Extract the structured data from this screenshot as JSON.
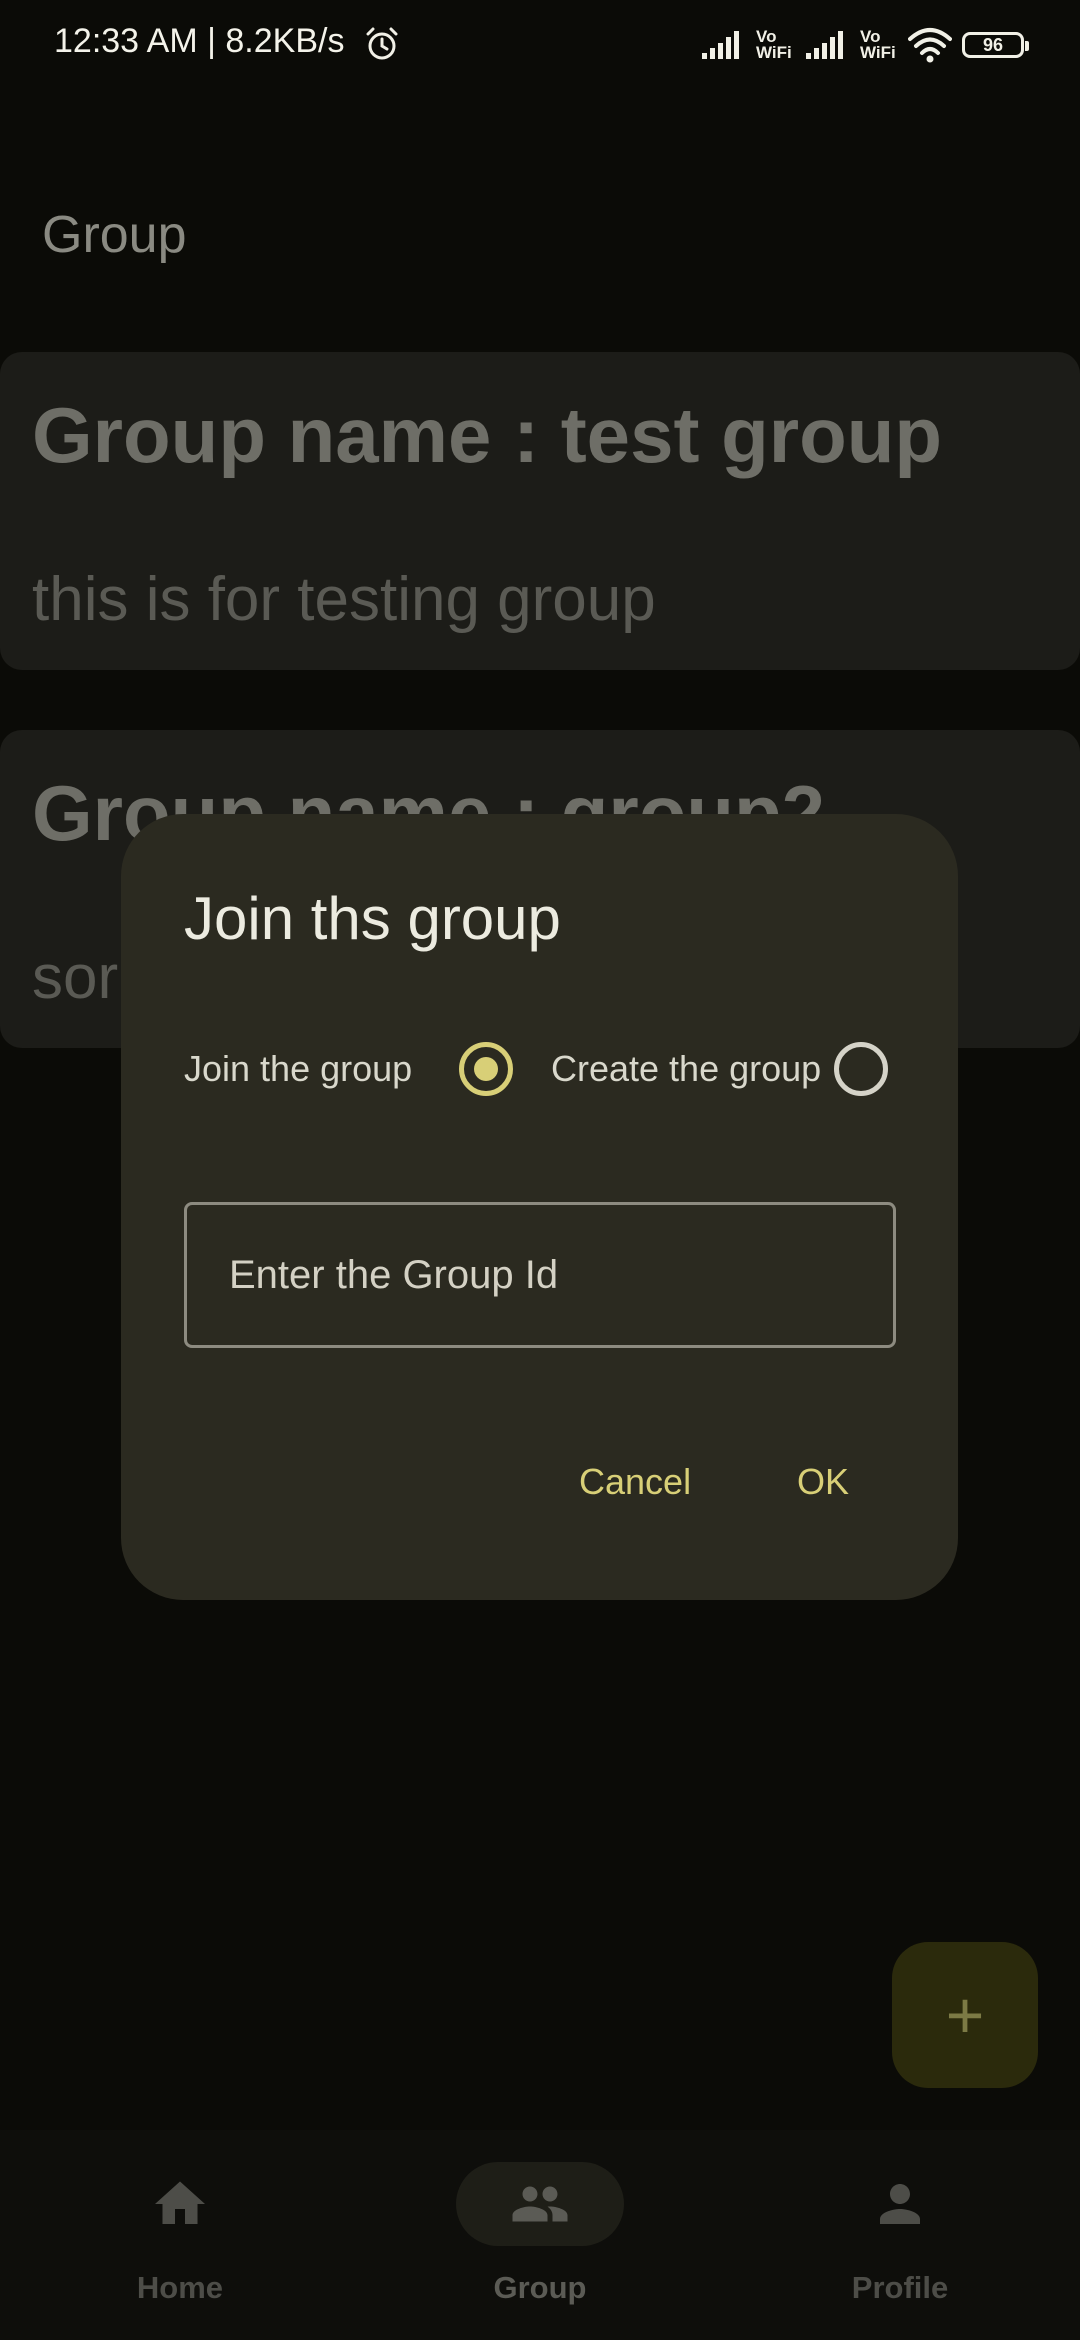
{
  "status_bar": {
    "time_and_speed": "12:33 AM | 8.2KB/s",
    "vowifi_1": "Vo WiFi",
    "vowifi_2": "Vo WiFi",
    "battery": "96"
  },
  "page": {
    "title": "Group"
  },
  "groups": [
    {
      "name": "Group name : test group",
      "description": "this is for testing group"
    },
    {
      "name": "Group name : group2",
      "description": "sor"
    }
  ],
  "fab": {
    "label": "+"
  },
  "bottom_nav": {
    "items": [
      {
        "label": "Home",
        "icon": "home-icon"
      },
      {
        "label": "Group",
        "icon": "group-icon"
      },
      {
        "label": "Profile",
        "icon": "person-icon"
      }
    ],
    "selected": "Group"
  },
  "dialog": {
    "title": "Join ths group",
    "radio_join_label": "Join the group",
    "radio_create_label": "Create the group",
    "selected_option": "Join the group",
    "input_placeholder": "Enter the Group Id",
    "input_value": "",
    "cancel_label": "Cancel",
    "ok_label": "OK"
  },
  "colors": {
    "accent": "#d8cf77",
    "dialog_background": "#2b2a20",
    "background": "#0b0b07"
  }
}
